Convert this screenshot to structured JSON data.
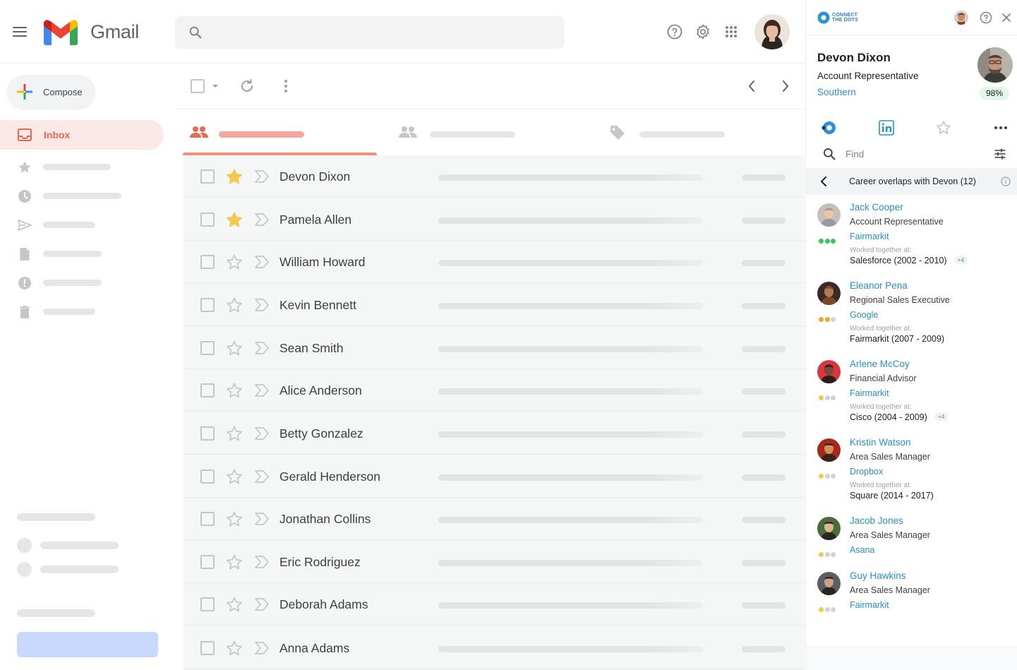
{
  "app": {
    "name": "Gmail",
    "search_placeholder": ""
  },
  "sidebar": {
    "compose_label": "Compose",
    "inbox_label": "Inbox"
  },
  "emails": [
    {
      "sender": "Devon Dixon",
      "starred": true
    },
    {
      "sender": "Pamela Allen",
      "starred": true
    },
    {
      "sender": "William Howard",
      "starred": false
    },
    {
      "sender": "Kevin Bennett",
      "starred": false
    },
    {
      "sender": "Sean Smith",
      "starred": false
    },
    {
      "sender": "Alice Anderson",
      "starred": false
    },
    {
      "sender": "Betty Gonzalez",
      "starred": false
    },
    {
      "sender": "Gerald Henderson",
      "starred": false
    },
    {
      "sender": "Jonathan Collins",
      "starred": false
    },
    {
      "sender": "Eric Rodriguez",
      "starred": false
    },
    {
      "sender": "Deborah Adams",
      "starred": false
    },
    {
      "sender": "Anna Adams",
      "starred": false
    }
  ],
  "panel": {
    "brand_line1": "CONNECT",
    "brand_line2": "THE DOTS",
    "profile": {
      "name": "Devon Dixon",
      "title": "Account Representative",
      "location": "Southern",
      "match": "98%"
    },
    "find_placeholder": "Find",
    "career_header": "Career overlaps with Devon (12)",
    "worked_together_label": "Worked together at:",
    "people": [
      {
        "name": "Jack Cooper",
        "title": "Account Representative",
        "company": "Fairmarkit",
        "overlap": "Salesforce (2002 - 2010)",
        "more": "+4",
        "strength": [
          "#34c759",
          "#34c759",
          "#34c759"
        ]
      },
      {
        "name": "Eleanor Pena",
        "title": "Regional Sales Executive",
        "company": "Google",
        "overlap": "Fairmarkit (2007 - 2009)",
        "more": "",
        "strength": [
          "#f5a623",
          "#f5a623",
          "#cfd3d6"
        ]
      },
      {
        "name": "Arlene McCoy",
        "title": "Financial Advisor",
        "company": "Fairmarkit",
        "overlap": "Cisco (2004 - 2009)",
        "more": "+4",
        "strength": [
          "#f2c94c",
          "#cfd3d6",
          "#cfd3d6"
        ]
      },
      {
        "name": "Kristin Watson",
        "title": "Area Sales Manager",
        "company": "Dropbox",
        "overlap": "Square (2014 - 2017)",
        "more": "",
        "strength": [
          "#f2c94c",
          "#cfd3d6",
          "#cfd3d6"
        ]
      },
      {
        "name": "Jacob Jones",
        "title": "Area Sales Manager",
        "company": "Asana",
        "overlap": "",
        "more": "",
        "strength": [
          "#f2c94c",
          "#cfd3d6",
          "#cfd3d6"
        ]
      },
      {
        "name": "Guy Hawkins",
        "title": "Area Sales Manager",
        "company": "Fairmarkit",
        "overlap": "",
        "more": "",
        "strength": [
          "#f2c94c",
          "#cfd3d6",
          "#cfd3d6"
        ]
      }
    ]
  },
  "colors": {
    "accent": "#e56a54",
    "link": "#2a8fc6",
    "star": "#f2c94c"
  }
}
